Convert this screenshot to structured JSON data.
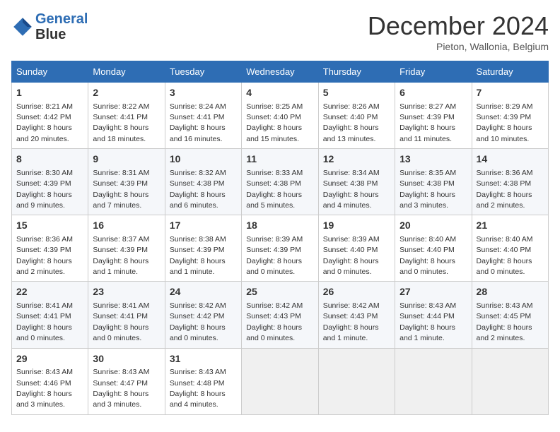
{
  "header": {
    "logo_line1": "General",
    "logo_line2": "Blue",
    "month": "December 2024",
    "location": "Pieton, Wallonia, Belgium"
  },
  "days_of_week": [
    "Sunday",
    "Monday",
    "Tuesday",
    "Wednesday",
    "Thursday",
    "Friday",
    "Saturday"
  ],
  "weeks": [
    [
      {
        "day": 1,
        "info": "Sunrise: 8:21 AM\nSunset: 4:42 PM\nDaylight: 8 hours\nand 20 minutes."
      },
      {
        "day": 2,
        "info": "Sunrise: 8:22 AM\nSunset: 4:41 PM\nDaylight: 8 hours\nand 18 minutes."
      },
      {
        "day": 3,
        "info": "Sunrise: 8:24 AM\nSunset: 4:41 PM\nDaylight: 8 hours\nand 16 minutes."
      },
      {
        "day": 4,
        "info": "Sunrise: 8:25 AM\nSunset: 4:40 PM\nDaylight: 8 hours\nand 15 minutes."
      },
      {
        "day": 5,
        "info": "Sunrise: 8:26 AM\nSunset: 4:40 PM\nDaylight: 8 hours\nand 13 minutes."
      },
      {
        "day": 6,
        "info": "Sunrise: 8:27 AM\nSunset: 4:39 PM\nDaylight: 8 hours\nand 11 minutes."
      },
      {
        "day": 7,
        "info": "Sunrise: 8:29 AM\nSunset: 4:39 PM\nDaylight: 8 hours\nand 10 minutes."
      }
    ],
    [
      {
        "day": 8,
        "info": "Sunrise: 8:30 AM\nSunset: 4:39 PM\nDaylight: 8 hours\nand 9 minutes."
      },
      {
        "day": 9,
        "info": "Sunrise: 8:31 AM\nSunset: 4:39 PM\nDaylight: 8 hours\nand 7 minutes."
      },
      {
        "day": 10,
        "info": "Sunrise: 8:32 AM\nSunset: 4:38 PM\nDaylight: 8 hours\nand 6 minutes."
      },
      {
        "day": 11,
        "info": "Sunrise: 8:33 AM\nSunset: 4:38 PM\nDaylight: 8 hours\nand 5 minutes."
      },
      {
        "day": 12,
        "info": "Sunrise: 8:34 AM\nSunset: 4:38 PM\nDaylight: 8 hours\nand 4 minutes."
      },
      {
        "day": 13,
        "info": "Sunrise: 8:35 AM\nSunset: 4:38 PM\nDaylight: 8 hours\nand 3 minutes."
      },
      {
        "day": 14,
        "info": "Sunrise: 8:36 AM\nSunset: 4:38 PM\nDaylight: 8 hours\nand 2 minutes."
      }
    ],
    [
      {
        "day": 15,
        "info": "Sunrise: 8:36 AM\nSunset: 4:39 PM\nDaylight: 8 hours\nand 2 minutes."
      },
      {
        "day": 16,
        "info": "Sunrise: 8:37 AM\nSunset: 4:39 PM\nDaylight: 8 hours\nand 1 minute."
      },
      {
        "day": 17,
        "info": "Sunrise: 8:38 AM\nSunset: 4:39 PM\nDaylight: 8 hours\nand 1 minute."
      },
      {
        "day": 18,
        "info": "Sunrise: 8:39 AM\nSunset: 4:39 PM\nDaylight: 8 hours\nand 0 minutes."
      },
      {
        "day": 19,
        "info": "Sunrise: 8:39 AM\nSunset: 4:40 PM\nDaylight: 8 hours\nand 0 minutes."
      },
      {
        "day": 20,
        "info": "Sunrise: 8:40 AM\nSunset: 4:40 PM\nDaylight: 8 hours\nand 0 minutes."
      },
      {
        "day": 21,
        "info": "Sunrise: 8:40 AM\nSunset: 4:40 PM\nDaylight: 8 hours\nand 0 minutes."
      }
    ],
    [
      {
        "day": 22,
        "info": "Sunrise: 8:41 AM\nSunset: 4:41 PM\nDaylight: 8 hours\nand 0 minutes."
      },
      {
        "day": 23,
        "info": "Sunrise: 8:41 AM\nSunset: 4:41 PM\nDaylight: 8 hours\nand 0 minutes."
      },
      {
        "day": 24,
        "info": "Sunrise: 8:42 AM\nSunset: 4:42 PM\nDaylight: 8 hours\nand 0 minutes."
      },
      {
        "day": 25,
        "info": "Sunrise: 8:42 AM\nSunset: 4:43 PM\nDaylight: 8 hours\nand 0 minutes."
      },
      {
        "day": 26,
        "info": "Sunrise: 8:42 AM\nSunset: 4:43 PM\nDaylight: 8 hours\nand 1 minute."
      },
      {
        "day": 27,
        "info": "Sunrise: 8:43 AM\nSunset: 4:44 PM\nDaylight: 8 hours\nand 1 minute."
      },
      {
        "day": 28,
        "info": "Sunrise: 8:43 AM\nSunset: 4:45 PM\nDaylight: 8 hours\nand 2 minutes."
      }
    ],
    [
      {
        "day": 29,
        "info": "Sunrise: 8:43 AM\nSunset: 4:46 PM\nDaylight: 8 hours\nand 3 minutes."
      },
      {
        "day": 30,
        "info": "Sunrise: 8:43 AM\nSunset: 4:47 PM\nDaylight: 8 hours\nand 3 minutes."
      },
      {
        "day": 31,
        "info": "Sunrise: 8:43 AM\nSunset: 4:48 PM\nDaylight: 8 hours\nand 4 minutes."
      },
      null,
      null,
      null,
      null
    ]
  ]
}
